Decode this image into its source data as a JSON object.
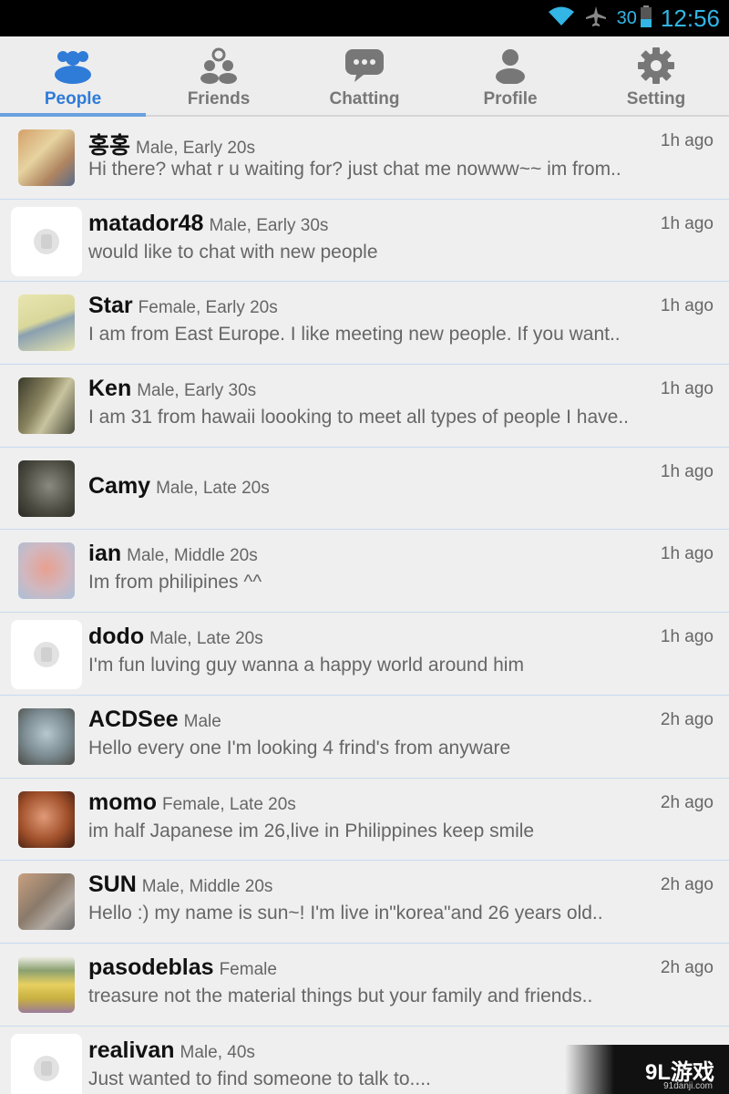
{
  "status_bar": {
    "battery_level": "30",
    "time": "12:56",
    "icons": [
      "wifi-icon",
      "airplane-icon",
      "battery-icon"
    ],
    "accent": "#33b5e5"
  },
  "tabs": [
    {
      "label": "People",
      "icon": "people-icon",
      "active": true
    },
    {
      "label": "Friends",
      "icon": "friends-icon",
      "active": false
    },
    {
      "label": "Chatting",
      "icon": "chat-bubble-icon",
      "active": false
    },
    {
      "label": "Profile",
      "icon": "profile-icon",
      "active": false
    },
    {
      "label": "Setting",
      "icon": "gear-icon",
      "active": false
    }
  ],
  "people": [
    {
      "name": "홍홍",
      "meta": "Male, Early 20s",
      "message": "Hi there? what r u waiting for? just chat me nowww~~ im from..",
      "time": "1h ago",
      "avatar": "photo"
    },
    {
      "name": "matador48",
      "meta": "Male, Early 30s",
      "message": "would like to chat with new people",
      "time": "1h ago",
      "avatar": "blank"
    },
    {
      "name": "Star",
      "meta": "Female, Early 20s",
      "message": "I am from East Europe. I like meeting new people. If you want..",
      "time": "1h ago",
      "avatar": "photo"
    },
    {
      "name": "Ken",
      "meta": "Male, Early 30s",
      "message": "I am 31 from hawaii loooking to meet all types of people I have..",
      "time": "1h ago",
      "avatar": "photo"
    },
    {
      "name": "Camy",
      "meta": "Male, Late 20s",
      "message": "",
      "time": "1h ago",
      "avatar": "photo"
    },
    {
      "name": "ian",
      "meta": "Male, Middle 20s",
      "message": "Im from philipines ^^",
      "time": "1h ago",
      "avatar": "photo"
    },
    {
      "name": "dodo",
      "meta": "Male, Late 20s",
      "message": "I'm fun luving guy wanna a happy world around him",
      "time": "1h ago",
      "avatar": "blank"
    },
    {
      "name": "ACDSee",
      "meta": "Male",
      "message": "Hello every one I'm looking 4 frind's from anyware",
      "time": "2h ago",
      "avatar": "photo"
    },
    {
      "name": "momo",
      "meta": "Female, Late 20s",
      "message": "im half Japanese im 26,live in Philippines keep smile",
      "time": "2h ago",
      "avatar": "photo"
    },
    {
      "name": "SUN",
      "meta": "Male, Middle 20s",
      "message": "Hello :) my name is sun~! I'm live in\"korea\"and 26 years old..",
      "time": "2h ago",
      "avatar": "photo"
    },
    {
      "name": "pasodeblas",
      "meta": "Female",
      "message": "treasure not the material things but your family and friends..",
      "time": "2h ago",
      "avatar": "photo"
    },
    {
      "name": "realivan",
      "meta": "Male, 40s",
      "message": "Just wanted to find someone to talk to....",
      "time": "",
      "avatar": "blank"
    }
  ],
  "watermark": {
    "main": "9L游戏",
    "sub": "91danji.com"
  }
}
